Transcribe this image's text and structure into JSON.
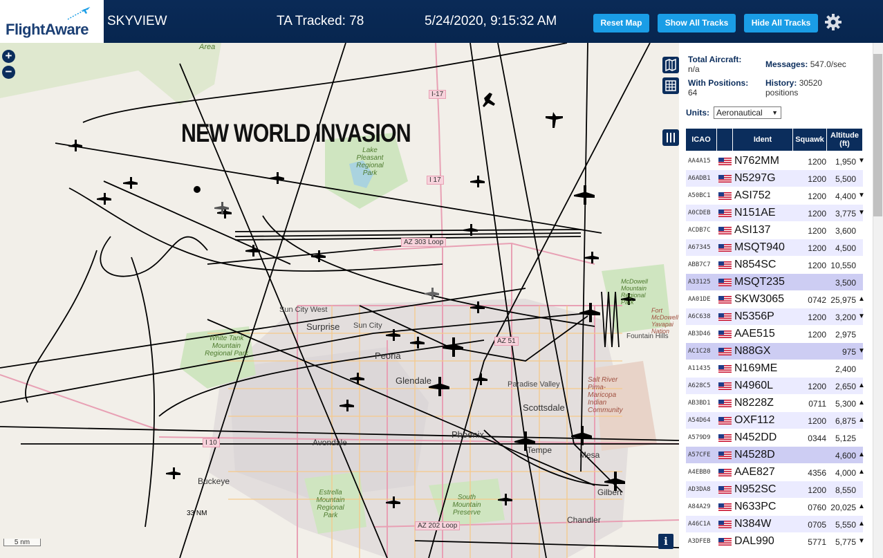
{
  "header": {
    "logo_text": "FlightAware",
    "app_title": "SKYVIEW",
    "tracked": "TA Tracked: 78",
    "datetime": "5/24/2020, 9:15:32 AM",
    "buttons": {
      "reset": "Reset Map",
      "show": "Show All Tracks",
      "hide": "Hide All Tracks"
    },
    "settings_icon": "gear-icon"
  },
  "map": {
    "banner": "NEW WORLD INVASION",
    "scale_label": "5 nm",
    "range_label": "33 NM",
    "zoom_in": "+",
    "zoom_out": "−",
    "info_label": "i",
    "places": [
      "Area",
      "Lake Pleasant Regional Park",
      "Sun City West",
      "Surprise",
      "Sun City",
      "White Tank Mountain Regional Park",
      "Peoria",
      "Glendale",
      "Paradise Valley",
      "Scottsdale",
      "Phoenix",
      "Avondale",
      "Buckeye",
      "Tempe",
      "Mesa",
      "Gilbert",
      "Chandler",
      "Estrella Mountain Regional Park",
      "South Mountain Preserve",
      "Fountain Hills",
      "McDowell Mountain Regional Park",
      "Fort McDowell Yavapai Nation",
      "Salt River Pima-Maricopa Indian Community"
    ],
    "roads": [
      "I-17",
      "I 17",
      "AZ 303 Loop",
      "AZ 51",
      "I 10",
      "AZ 202 Loop"
    ]
  },
  "stats": {
    "total_label": "Total Aircraft:",
    "total_value": "n/a",
    "positions_label": "With Positions:",
    "positions_value": "64",
    "messages_label": "Messages:",
    "messages_value": "547.0/sec",
    "history_label": "History:",
    "history_value": "30520",
    "history_unit": "positions"
  },
  "units": {
    "label": "Units:",
    "selected": "Aeronautical"
  },
  "table": {
    "headers": {
      "icao": "ICAO",
      "ident": "Ident",
      "squawk": "Squawk",
      "altitude": "Altitude",
      "altitude_unit": "(ft)"
    },
    "rows": [
      {
        "icao": "AA4A15",
        "ident": "N762MM",
        "squawk": "1200",
        "alt": "1,950",
        "trend": "▼",
        "style": ""
      },
      {
        "icao": "A6ADB1",
        "ident": "N5297G",
        "squawk": "1200",
        "alt": "5,500",
        "trend": "",
        "style": "alt"
      },
      {
        "icao": "A50BC1",
        "ident": "ASI752",
        "squawk": "1200",
        "alt": "4,400",
        "trend": "▼",
        "style": ""
      },
      {
        "icao": "A0CDEB",
        "ident": "N151AE",
        "squawk": "1200",
        "alt": "3,775",
        "trend": "▼",
        "style": "alt"
      },
      {
        "icao": "ACDB7C",
        "ident": "ASI137",
        "squawk": "1200",
        "alt": "3,600",
        "trend": "",
        "style": ""
      },
      {
        "icao": "A67345",
        "ident": "MSQT940",
        "squawk": "1200",
        "alt": "4,500",
        "trend": "",
        "style": "alt"
      },
      {
        "icao": "ABB7C7",
        "ident": "N854SC",
        "squawk": "1200",
        "alt": "10,550",
        "trend": "",
        "style": ""
      },
      {
        "icao": "A33125",
        "ident": "MSQT235",
        "squawk": "",
        "alt": "3,500",
        "trend": "",
        "style": "sel"
      },
      {
        "icao": "AA01DE",
        "ident": "SKW3065",
        "squawk": "0742",
        "alt": "25,975",
        "trend": "▲",
        "style": ""
      },
      {
        "icao": "A6C638",
        "ident": "N5356P",
        "squawk": "1200",
        "alt": "3,200",
        "trend": "▼",
        "style": "alt"
      },
      {
        "icao": "AB3D46",
        "ident": "AAE515",
        "squawk": "1200",
        "alt": "2,975",
        "trend": "",
        "style": ""
      },
      {
        "icao": "AC1C28",
        "ident": "N88GX",
        "squawk": "",
        "alt": "975",
        "trend": "▼",
        "style": "sel"
      },
      {
        "icao": "A11435",
        "ident": "N169ME",
        "squawk": "",
        "alt": "2,400",
        "trend": "",
        "style": ""
      },
      {
        "icao": "A628C5",
        "ident": "N4960L",
        "squawk": "1200",
        "alt": "2,650",
        "trend": "▲",
        "style": "alt"
      },
      {
        "icao": "AB3BD1",
        "ident": "N8228Z",
        "squawk": "0711",
        "alt": "5,300",
        "trend": "▲",
        "style": ""
      },
      {
        "icao": "A54D64",
        "ident": "OXF112",
        "squawk": "1200",
        "alt": "6,875",
        "trend": "▲",
        "style": "alt"
      },
      {
        "icao": "A579D9",
        "ident": "N452DD",
        "squawk": "0344",
        "alt": "5,125",
        "trend": "",
        "style": ""
      },
      {
        "icao": "A57CFE",
        "ident": "N4528D",
        "squawk": "",
        "alt": "4,600",
        "trend": "▲",
        "style": "sel"
      },
      {
        "icao": "A4EBB0",
        "ident": "AAE827",
        "squawk": "4356",
        "alt": "4,000",
        "trend": "▲",
        "style": ""
      },
      {
        "icao": "AD3DA8",
        "ident": "N952SC",
        "squawk": "1200",
        "alt": "8,550",
        "trend": "",
        "style": "alt"
      },
      {
        "icao": "A84A29",
        "ident": "N633PC",
        "squawk": "0760",
        "alt": "20,025",
        "trend": "▲",
        "style": ""
      },
      {
        "icao": "A46C1A",
        "ident": "N384W",
        "squawk": "0705",
        "alt": "5,550",
        "trend": "▲",
        "style": "alt"
      },
      {
        "icao": "A3DFEB",
        "ident": "DAL990",
        "squawk": "5771",
        "alt": "5,775",
        "trend": "▼",
        "style": ""
      }
    ]
  }
}
